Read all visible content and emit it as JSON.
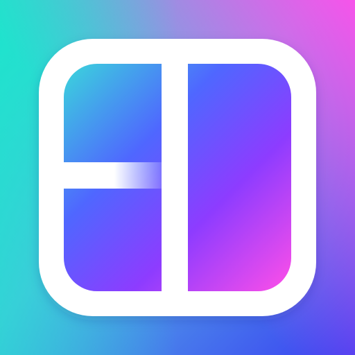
{
  "app_icon": {
    "name": "collage-layout-icon",
    "colors": {
      "background_top_left": "#1de5cc",
      "background_top_right": "#ff4fea",
      "background_bottom_left": "#2fc6e6",
      "background_bottom_right": "#3a3ff2",
      "frame": "#ffffff",
      "panel_teal": "#3ad6db",
      "panel_blue": "#4f67ff",
      "panel_violet": "#8d3cff",
      "panel_pink": "#ff4fe8"
    }
  }
}
